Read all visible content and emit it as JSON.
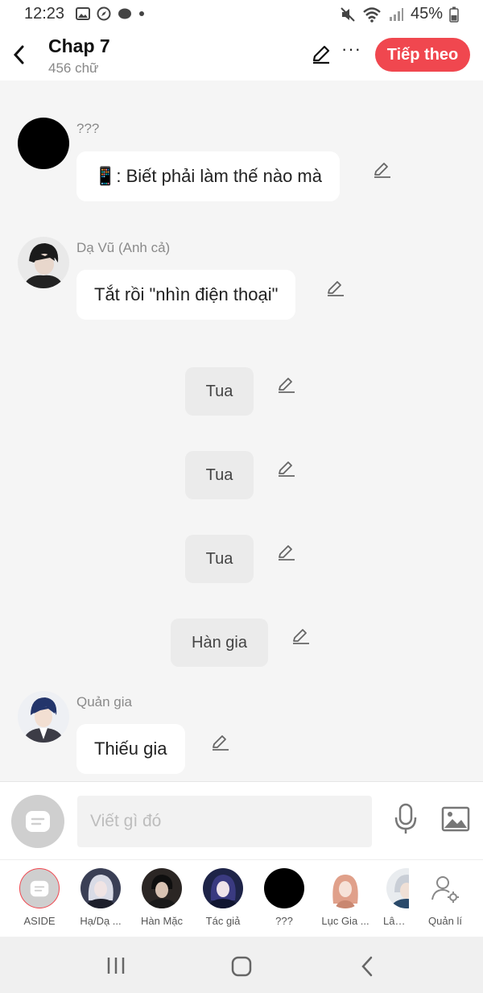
{
  "status_bar": {
    "time": "12:23",
    "battery": "45%"
  },
  "header": {
    "title": "Chap 7",
    "subtitle": "456 chữ",
    "next_label": "Tiếp theo",
    "more": "···"
  },
  "messages": [
    {
      "type": "dialog",
      "name": "???",
      "text": "📱: Biết phải làm thế nào mà"
    },
    {
      "type": "dialog",
      "name": "Dạ Vũ (Anh cả)",
      "text": "Tắt rồi \"nhìn điện thoại\""
    },
    {
      "type": "narration",
      "text": "Tua"
    },
    {
      "type": "narration",
      "text": "Tua"
    },
    {
      "type": "narration",
      "text": "Tua"
    },
    {
      "type": "narration",
      "text": "Hàn gia"
    },
    {
      "type": "dialog",
      "name": "Quản gia",
      "text": "Thiếu gia"
    }
  ],
  "composer": {
    "placeholder": "Viết gì đó"
  },
  "characters": [
    {
      "label": "ASIDE"
    },
    {
      "label": "Hạ/Dạ ..."
    },
    {
      "label": "Hàn Mặc"
    },
    {
      "label": "Tác giả"
    },
    {
      "label": "???"
    },
    {
      "label": "Lục Gia ..."
    },
    {
      "label": "Lân H"
    },
    {
      "label": "Quản lí"
    }
  ],
  "colors": {
    "accent": "#f0474f",
    "background": "#f5f5f5"
  }
}
